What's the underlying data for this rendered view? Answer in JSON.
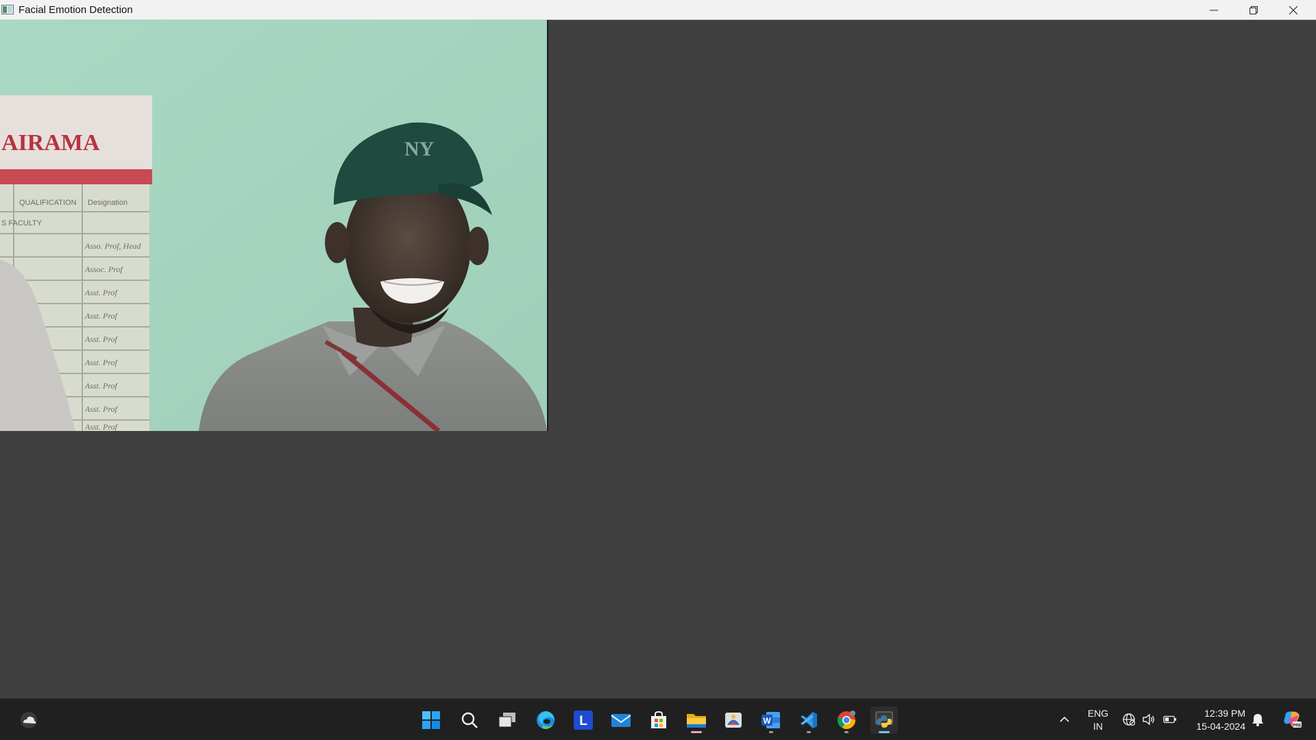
{
  "window": {
    "title": "Facial Emotion Detection",
    "controls": [
      "minimize",
      "restore",
      "close"
    ]
  },
  "video_feed": {
    "background_sign": {
      "heading": "AIRAMA",
      "columns": [
        "QUALIFICATION",
        "Designation"
      ],
      "section": "S FACULTY",
      "rows": [
        "Asso. Prof, Head",
        "Assoc. Prof",
        "Asst. Prof",
        "Asst. Prof",
        "Asst. Prof",
        "Asst. Prof",
        "Asst. Prof",
        "Asst. Prof",
        "Asst. Prof"
      ]
    },
    "cap_logo": "NY"
  },
  "taskbar": {
    "widget_icon": "weather-cloud-icon",
    "apps": [
      {
        "name": "start",
        "icon": "windows-start-icon"
      },
      {
        "name": "search",
        "icon": "search-icon"
      },
      {
        "name": "task-view",
        "icon": "task-view-icon"
      },
      {
        "name": "edge",
        "icon": "edge-browser-icon"
      },
      {
        "name": "l-app",
        "icon": "l-app-icon",
        "letter": "L"
      },
      {
        "name": "mail",
        "icon": "mail-icon"
      },
      {
        "name": "store",
        "icon": "store-icon"
      },
      {
        "name": "file-explorer",
        "icon": "folder-icon"
      },
      {
        "name": "photos",
        "icon": "photos-icon"
      },
      {
        "name": "word",
        "icon": "word-icon",
        "letter": "W"
      },
      {
        "name": "vscode",
        "icon": "vscode-icon"
      },
      {
        "name": "chrome",
        "icon": "chrome-icon"
      },
      {
        "name": "python",
        "icon": "python-icon"
      }
    ],
    "tray": {
      "language_line1": "ENG",
      "language_line2": "IN",
      "time": "12:39 PM",
      "date": "15-04-2024"
    }
  },
  "colors": {
    "titlebar": "#f2f2f2",
    "client_background": "#404040",
    "taskbar": "#202020"
  }
}
